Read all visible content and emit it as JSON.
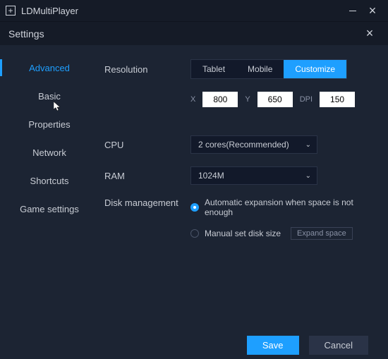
{
  "titlebar": {
    "app_name": "LDMultiPlayer"
  },
  "subheader": {
    "title": "Settings"
  },
  "sidebar": {
    "items": [
      {
        "label": "Advanced",
        "active": true
      },
      {
        "label": "Basic"
      },
      {
        "label": "Properties"
      },
      {
        "label": "Network"
      },
      {
        "label": "Shortcuts"
      },
      {
        "label": "Game settings"
      }
    ]
  },
  "content": {
    "resolution": {
      "label": "Resolution",
      "tabs": [
        {
          "label": "Tablet"
        },
        {
          "label": "Mobile"
        },
        {
          "label": "Customize",
          "active": true
        }
      ],
      "x_label": "X",
      "x_value": "800",
      "y_label": "Y",
      "y_value": "650",
      "dpi_label": "DPI",
      "dpi_value": "150"
    },
    "cpu": {
      "label": "CPU",
      "value": "2 cores(Recommended)"
    },
    "ram": {
      "label": "RAM",
      "value": "1024M"
    },
    "disk": {
      "label": "Disk management",
      "opt_auto": "Automatic expansion when space is not enough",
      "opt_manual": "Manual set disk size",
      "expand_btn": "Expand space"
    }
  },
  "footer": {
    "save": "Save",
    "cancel": "Cancel"
  }
}
